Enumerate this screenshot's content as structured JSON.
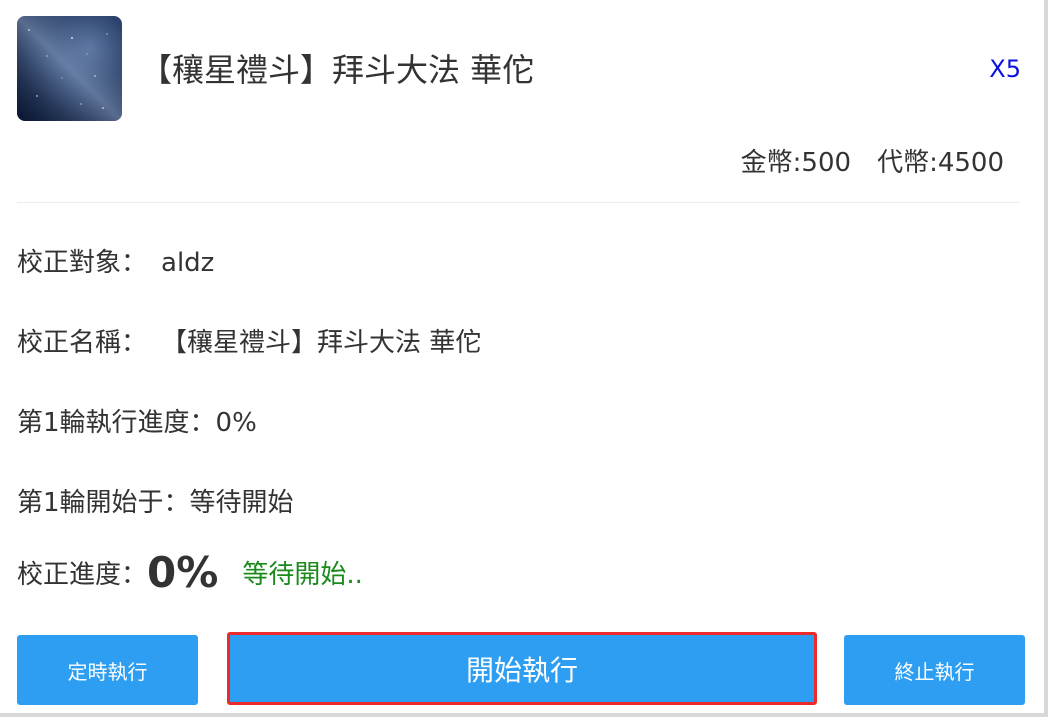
{
  "header": {
    "title": "【穰星禮斗】拜斗大法 華佗",
    "multiplier": "X5"
  },
  "balance": {
    "gold": "金幣:500",
    "tokens": "代幣:4500"
  },
  "details": {
    "target_label": "校正對象：",
    "target_value": "aldz",
    "name_label": "校正名稱：",
    "name_value": "【穰星禮斗】拜斗大法 華佗",
    "round_progress_label": "第1輪執行進度：",
    "round_progress_value": "0%",
    "round_start_label": "第1輪開始于：",
    "round_start_value": "等待開始"
  },
  "progress": {
    "label": "校正進度：",
    "value": "0%",
    "status": "等待開始..",
    "status_color": "#1a8a1a"
  },
  "buttons": {
    "timer": "定時執行",
    "start": "開始執行",
    "stop": "終止執行"
  },
  "icons": {
    "thumbnail": "starry-sky-image"
  },
  "colors": {
    "accent": "#2e9ef2",
    "highlight_border": "#ec2a2a",
    "multiplier": "#0a10e0"
  }
}
